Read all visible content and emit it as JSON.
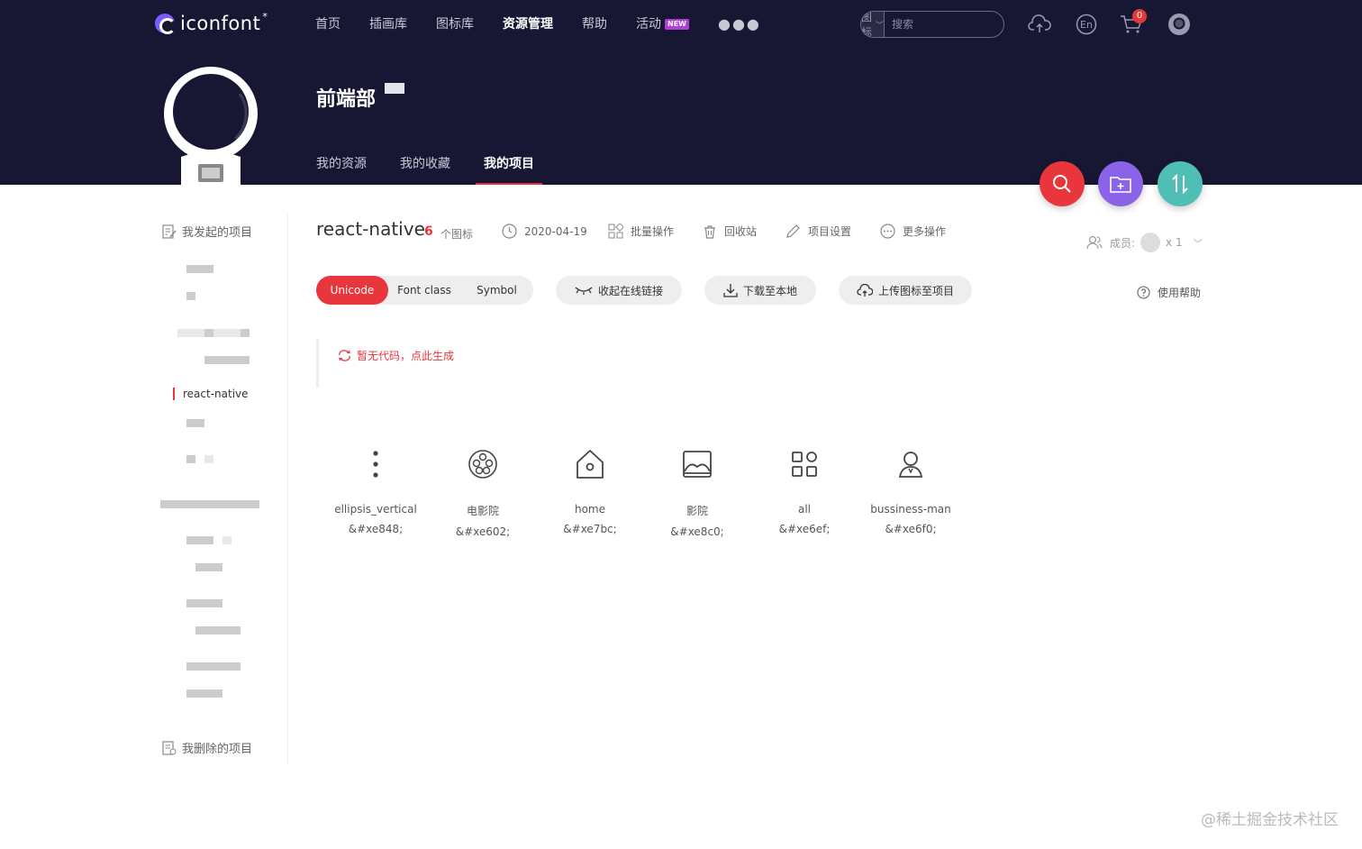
{
  "header": {
    "logo_text": "iconfont",
    "logo_star": "*",
    "nav": [
      "首页",
      "插画库",
      "图标库",
      "资源管理",
      "帮助",
      "活动"
    ],
    "nav_active_index": 3,
    "new_badge": "NEW",
    "search": {
      "type": "图标",
      "placeholder": "搜索"
    },
    "cart_count": "0",
    "lang_label": "En"
  },
  "team": {
    "name": "前端部",
    "tabs": [
      "我的资源",
      "我的收藏",
      "我的项目"
    ],
    "active_tab_index": 2
  },
  "sidebar": {
    "started_projects": "我发起的项目",
    "active_project": "react-native",
    "deleted_projects": "我删除的项目"
  },
  "project": {
    "title": "react-native",
    "icon_count": "6",
    "icon_count_label": "个图标",
    "date": "2020-04-19",
    "batch": "批量操作",
    "recycle": "回收站",
    "settings": "项目设置",
    "more": "更多操作",
    "members_label": "成员:",
    "members_count": "x 1"
  },
  "toolbar": {
    "segments": [
      "Unicode",
      "Font class",
      "Symbol"
    ],
    "active_segment": 0,
    "collapse_link": "收起在线链接",
    "download": "下载至本地",
    "upload": "上传图标至项目",
    "help": "使用帮助"
  },
  "code": {
    "generate_hint": "暂无代码，点此生成"
  },
  "icons": [
    {
      "name": "ellipsis_vertical",
      "code": "&#xe848;",
      "icon": "ellipsis-vertical-icon"
    },
    {
      "name": "电影院",
      "code": "&#xe602;",
      "icon": "film-reel-icon"
    },
    {
      "name": "home",
      "code": "&#xe7bc;",
      "icon": "home-icon"
    },
    {
      "name": "影院",
      "code": "&#xe8c0;",
      "icon": "picture-icon"
    },
    {
      "name": "all",
      "code": "&#xe6ef;",
      "icon": "grid-icon"
    },
    {
      "name": "bussiness-man",
      "code": "&#xe6f0;",
      "icon": "user-icon"
    }
  ],
  "watermark": "@稀土掘金技术社区",
  "colors": {
    "header_bg": "#171733",
    "accent_red": "#e8363c",
    "purple": "#8a63e8",
    "teal": "#4fbfb6"
  }
}
